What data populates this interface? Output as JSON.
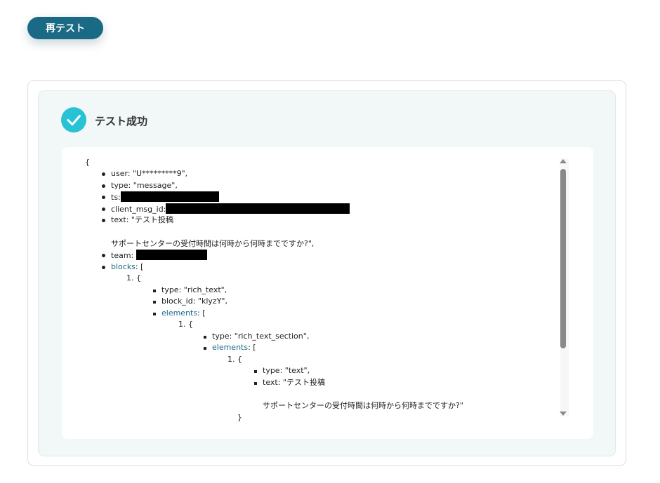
{
  "header": {
    "retest_label": "再テスト"
  },
  "result": {
    "title": "テスト成功",
    "icon": "check-circle-icon",
    "accent_color": "#27c2d3",
    "button_color": "#1a6a85"
  },
  "json_view": {
    "open_brace": "{",
    "user": "user: \"U*********9\",",
    "type": "type: \"message\",",
    "ts_key": "ts:",
    "client_msg_id_key": "client_msg_id:",
    "text_line1": "text: \"テスト投稿",
    "text_line2": "サポートセンターの受付時間は何時から何時までですか?\",",
    "team_key": "team:",
    "blocks_key": "blocks",
    "blocks_bracket": ": [",
    "block1_number": "1. {",
    "block1_type": "type: \"rich_text\",",
    "block1_block_id": "block_id: \"klyzY\",",
    "block1_elements_key": "elements",
    "block1_elements_bracket": ": [",
    "section1_number": "1. {",
    "section1_type": "type: \"rich_text_section\",",
    "section1_elements_key": "elements",
    "section1_elements_bracket": ": [",
    "text1_number": "1. {",
    "text1_type": "type: \"text\",",
    "text1_text_line1": "text: \"テスト投稿",
    "text1_text_line2": "サポートセンターの受付時間は何時から何時までですか?\"",
    "close_brace": "}"
  }
}
